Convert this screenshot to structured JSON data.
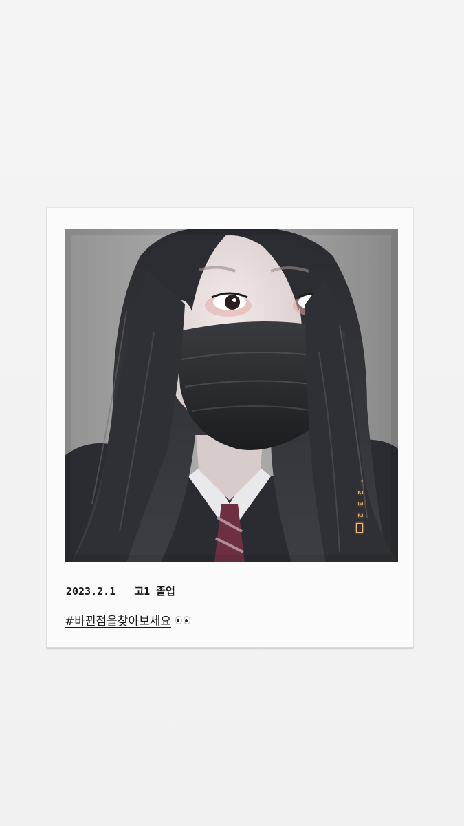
{
  "caption": {
    "date_line": "2023.2.1   고1 졸업",
    "hashtag": "#바뀐점을찾아보세요",
    "emoji_icon": "eyes-icon"
  },
  "photo": {
    "description_icon": "portrait-photo",
    "date_stamp": [
      "'",
      "2",
      "3",
      "2",
      "1"
    ]
  },
  "colors": {
    "background": "#f3f3f3",
    "polaroid_frame": "#fbfbfb",
    "stamp": "#f0b87a",
    "text": "#1a1a1a"
  }
}
